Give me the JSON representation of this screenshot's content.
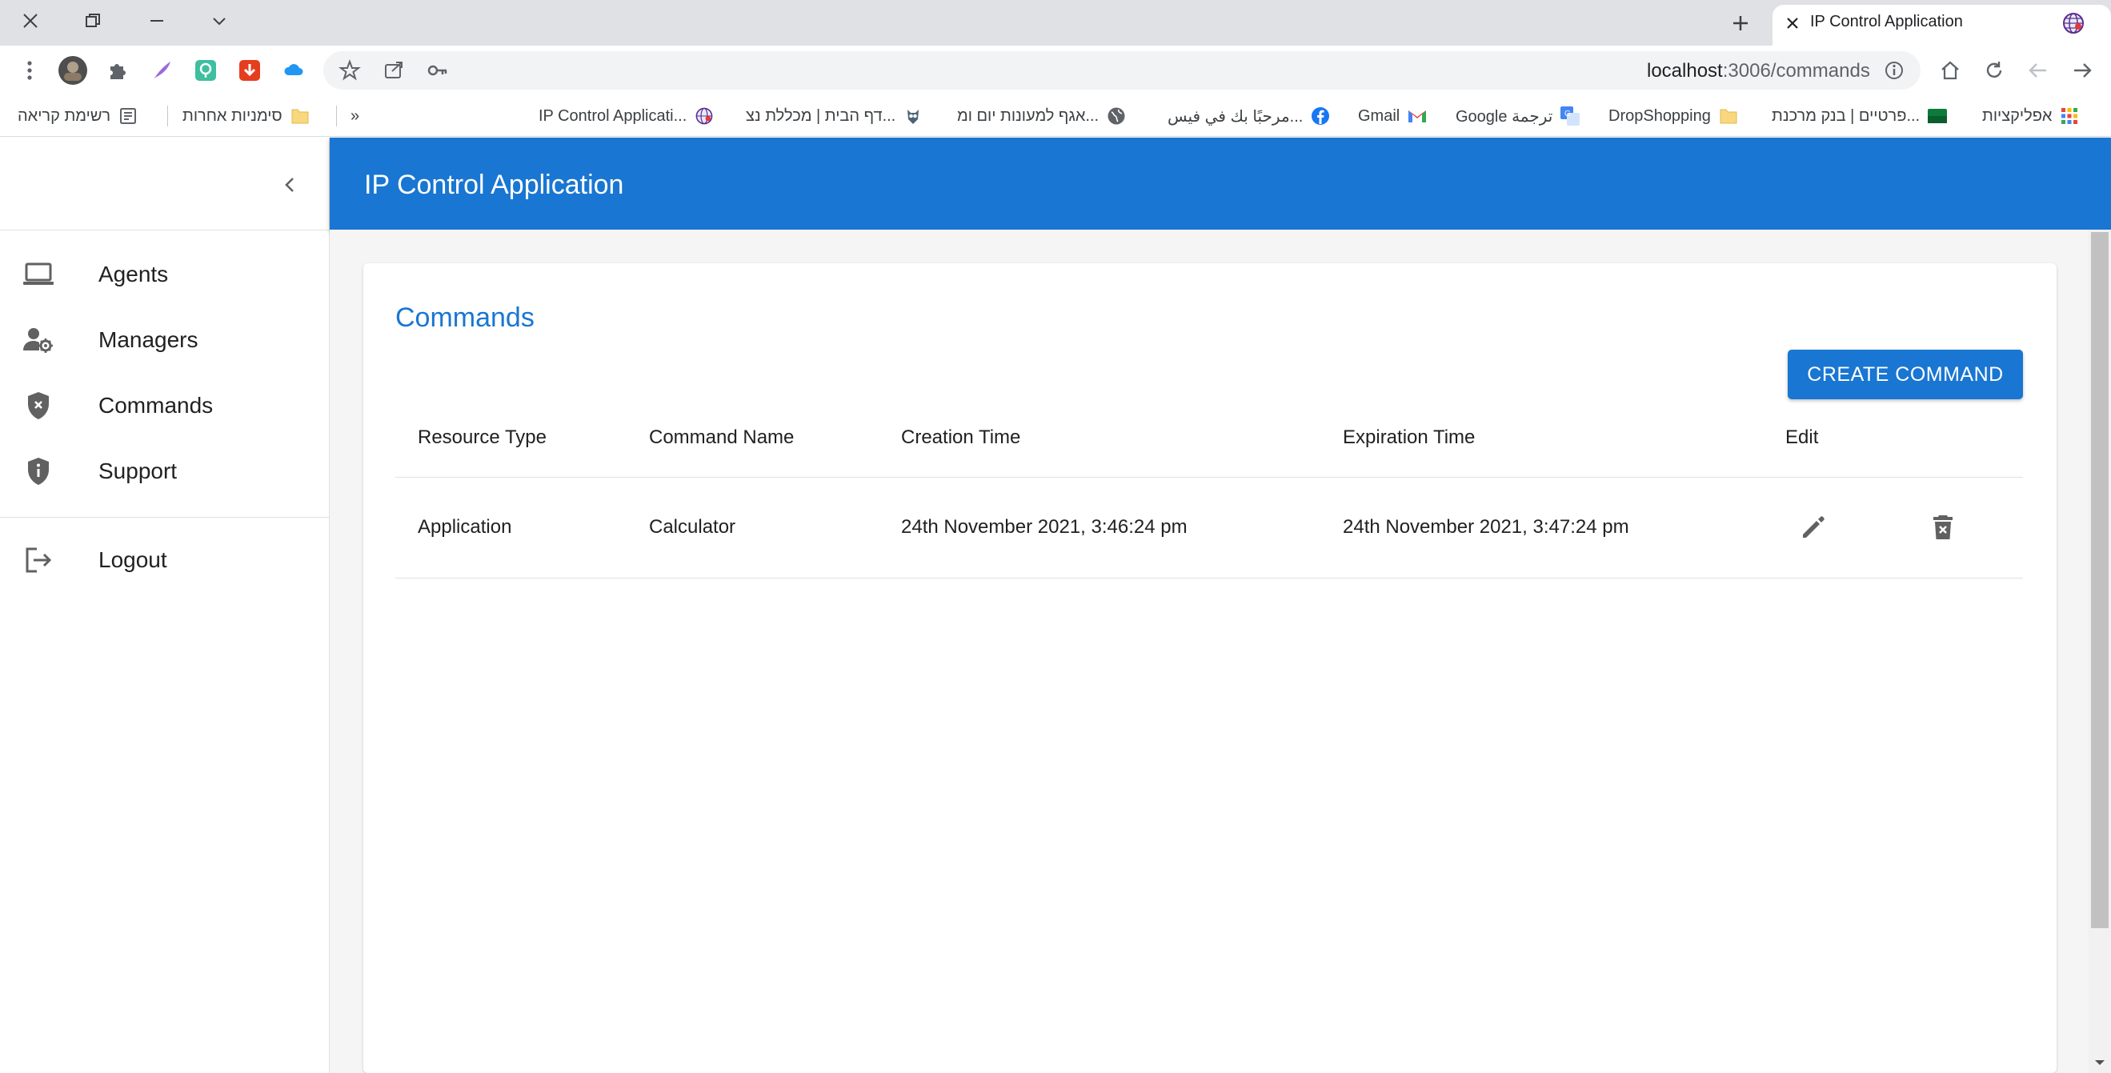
{
  "browser": {
    "tab_title": "IP Control Application",
    "url_host": "localhost",
    "url_path": ":3006/commands",
    "bookmarks": [
      {
        "label": "אפליקציות",
        "icon": "apps-grid-icon"
      },
      {
        "label": "פרטיים | בנק מרכנת...",
        "icon": "bank-icon"
      },
      {
        "label": "DropShopping",
        "icon": "folder-icon"
      },
      {
        "label": "Google ترجمة",
        "icon": "translate-icon"
      },
      {
        "label": "Gmail",
        "icon": "gmail-icon"
      },
      {
        "label": "مرحبًا بك في فيس...",
        "icon": "facebook-icon"
      },
      {
        "label": "אגף למעונות יום ומ...",
        "icon": "globe-icon"
      },
      {
        "label": "דף הבית | מכללת נצ...",
        "icon": "owl-icon"
      },
      {
        "label": "IP Control Applicati...",
        "icon": "app-globe-icon"
      },
      {
        "label": "»",
        "icon": "overflow-chevron-icon"
      },
      {
        "label": "סימניות אחרות",
        "icon": "folder-icon"
      },
      {
        "label": "רשימת קריאה",
        "icon": "reading-list-icon"
      }
    ]
  },
  "app": {
    "title": "IP Control Application"
  },
  "sidebar": {
    "items": [
      {
        "label": "Agents",
        "icon": "laptop-icon"
      },
      {
        "label": "Managers",
        "icon": "manager-gear-icon"
      },
      {
        "label": "Commands",
        "icon": "shield-x-icon"
      },
      {
        "label": "Support",
        "icon": "shield-info-icon"
      },
      {
        "label": "Logout",
        "icon": "logout-icon"
      }
    ]
  },
  "page": {
    "title": "Commands",
    "create_button": "CREATE COMMAND",
    "columns": [
      "Resource Type",
      "Command Name",
      "Creation Time",
      "Expiration Time",
      "Edit"
    ],
    "rows": [
      {
        "resource_type": "Application",
        "command_name": "Calculator",
        "creation_time": "24th November 2021, 3:46:24 pm",
        "expiration_time": "24th November 2021, 3:47:24 pm"
      }
    ]
  },
  "colors": {
    "primary": "#1976d2",
    "background": "#f5f5f5"
  }
}
